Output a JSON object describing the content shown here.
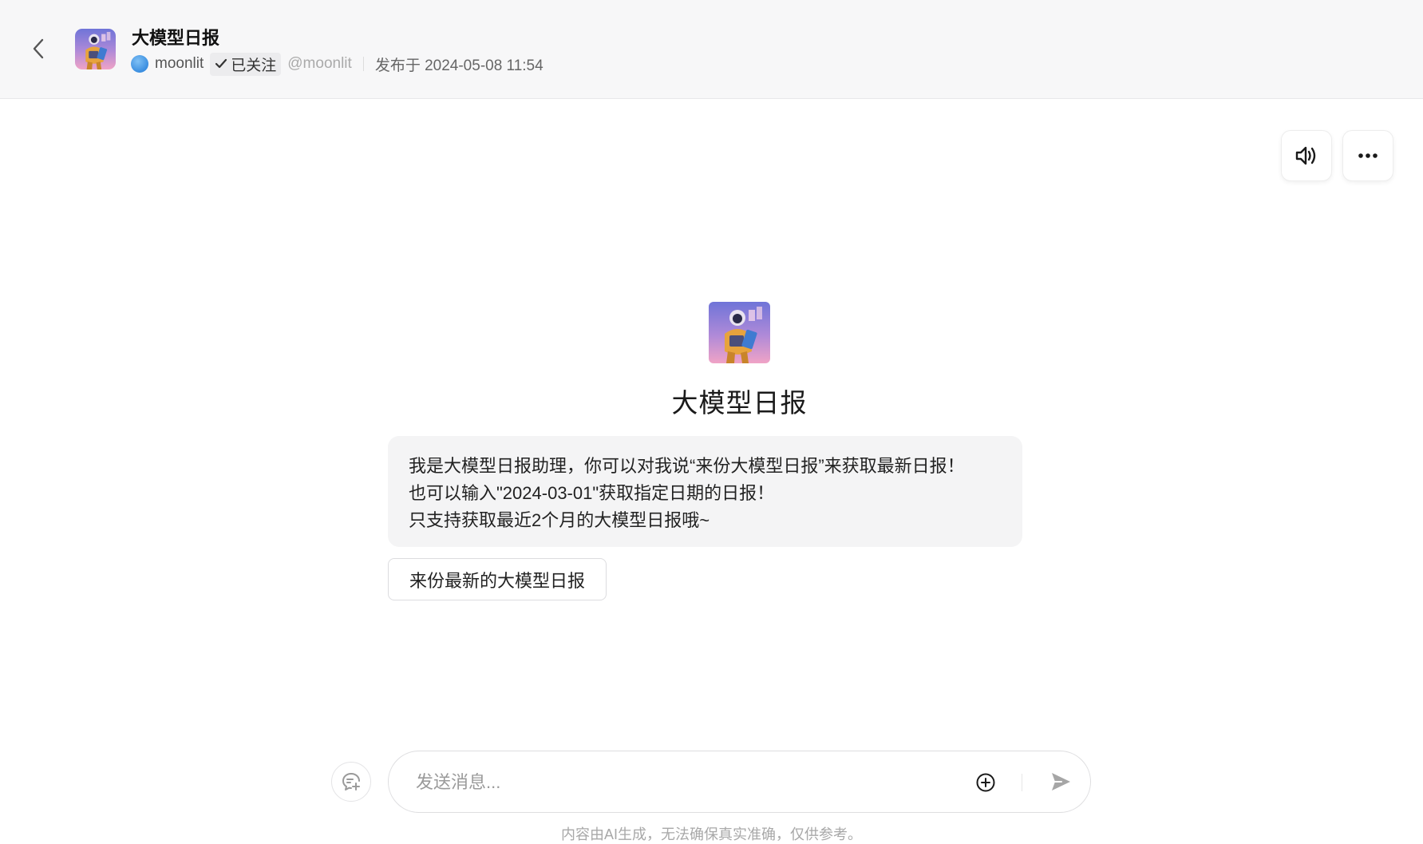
{
  "header": {
    "title": "大模型日报",
    "author_name": "moonlit",
    "follow_status": "已关注",
    "handle": "@moonlit",
    "published": "发布于 2024-05-08 11:54"
  },
  "toolbar": {
    "voice_icon": "speaker-icon",
    "more_icon": "more-dots-icon"
  },
  "bot": {
    "name": "大模型日报",
    "welcome_lines": [
      "我是大模型日报助理，你可以对我说“来份大模型日报”来获取最新日报！",
      "也可以输入\"2024-03-01\"获取指定日期的日报！",
      "只支持获取最近2个月的大模型日报哦~"
    ],
    "suggestion": "来份最新的大模型日报"
  },
  "composer": {
    "placeholder": "发送消息...",
    "disclaimer": "内容由AI生成，无法确保真实准确，仅供参考。"
  },
  "colors": {
    "header_bg": "#f7f7f8",
    "bubble_bg": "#f4f4f5",
    "author_dot": "#3a8ee0"
  }
}
